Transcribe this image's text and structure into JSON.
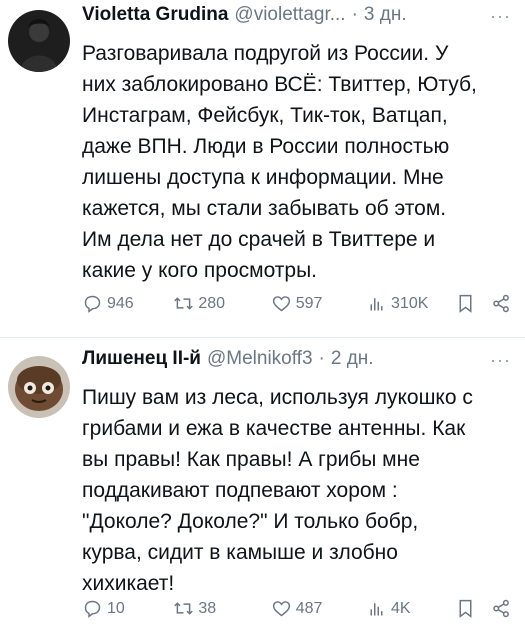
{
  "tweets": [
    {
      "name": "Violetta Grudina",
      "handle": "@violettagr...",
      "separator": "·",
      "time": "3 дн.",
      "more": "···",
      "text": "Разговаривала подругой из России. У\nних заблокировано ВСЁ: Твиттер, Ютуб,\nИнстаграм, Фейсбук, Тик-ток, Ватцап,\nдаже ВПН. Люди в России полностью\nлишены доступа к информации. Мне\nкажется, мы стали забывать об этом.\nИм дела нет до срачей в Твиттере и\nкакие у кого просмотры.",
      "replies": "946",
      "retweets": "280",
      "likes": "597",
      "views": "310K"
    },
    {
      "name": "Лишенец II-й",
      "handle": "@Melnikoff3",
      "separator": "·",
      "time": "2 дн.",
      "more": "···",
      "text": "Пишу вам из леса, используя лукошко с\nгрибами и ежа в качестве антенны. Как\nвы правы! Как правы! А грибы мне\nподдакивают подпевают хором :\n\"Доколе? Доколе?\" И только бобр,\nкурва, сидит в камыше и злобно\nхихикает!",
      "replies": "10",
      "retweets": "38",
      "likes": "487",
      "views": "4K"
    }
  ],
  "icons": {
    "reply": "reply-icon",
    "retweet": "retweet-icon",
    "like": "heart-icon",
    "views": "views-chart-icon",
    "bookmark": "bookmark-icon",
    "share": "share-icon"
  },
  "colors": {
    "text": "#0f1419",
    "secondary": "#6b7785",
    "divider": "#e6ecf0"
  }
}
